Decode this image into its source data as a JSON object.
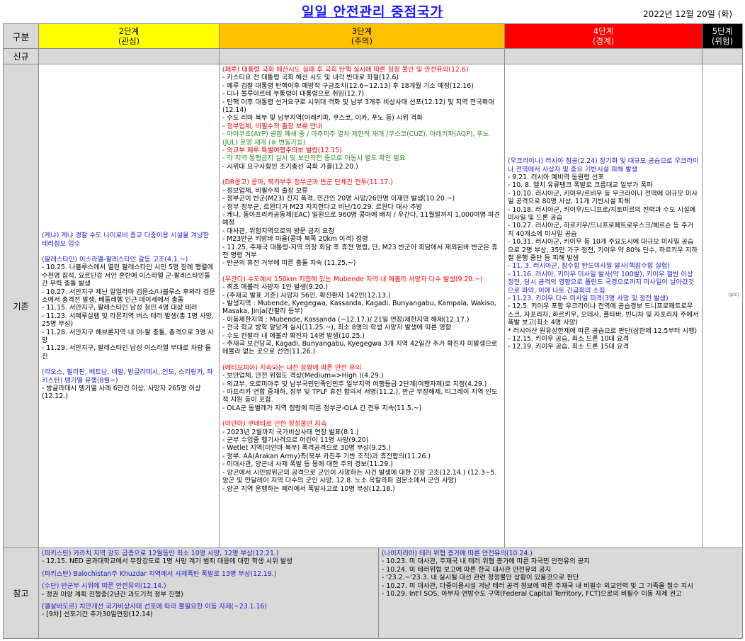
{
  "page": {
    "title": "일일 안전관리 중점국가",
    "date": "2022년  12월  20일 (화)"
  },
  "header": {
    "gubun": "구분",
    "level2": {
      "name": "2단계",
      "sub": "(관심)"
    },
    "level3": {
      "name": "3단계",
      "sub": "(주의)"
    },
    "level4": {
      "name": "4단계",
      "sub": "(경계)"
    },
    "level5": {
      "name": "5단계",
      "sub": "(위험)"
    }
  },
  "rows": {
    "new_label": "신규",
    "existing_label": "기존",
    "ref_label": "참고"
  },
  "level2": {
    "blocks": [
      {
        "head": "(케냐) 케냐 경찰 수도 나이로비 종교 다중이용 시설을 겨냥한 테러첩보 입수",
        "lines": []
      },
      {
        "head": "(팔레스타인) 이스라엘-팔레스타인 갈등 고조(4.1.~)",
        "lines": [
          "- 10.25. 나블루스에서 열린 팔레스타인 시민 5명 장례 행렬에 수천명 참석, 요르단강 서안 혼란에 이스라엘 군-팔레스타인들 간 무력 충돌 발생",
          "- 10.27. 서안지구 제닌 알일라마 검문소/나블루스 후와라 검문소에서 총격전 발생, 베들레헴 인근 데이세에서 총돌",
          "- 11.15. 서안지구, 팔레스타인 남성 청인 4명 대상 테러",
          "- 11.23. 서예루살렘 및 라몬지역 버스 테러 발생(총 1명 사망, 25명 부상)",
          "- 11.28. 서안지구 헤브론지역 내 이-팔 충돌, 총격으로 3명 사망",
          "- 11.29. 서안지구, 팔레스타인 남성 이스라엘 부대로 차량 돌진"
        ]
      },
      {
        "head": "(라오스, 필리핀, 베트남, 네팔, 방글라데시, 인도, 스리랑카, 파키스탄) 뎅기열 유행(8월~)",
        "lines": [
          "- 방글라데시 뎅기열 사례 6만건 이상, 사망자 265명 이상(12.12.)"
        ]
      }
    ]
  },
  "level3": {
    "blocks": [
      {
        "head": "(페루) 대통령 국회 해산시도 실패 후 국회 탄핵 실시에 따른 정정 불안 및 안전유의(12.6)",
        "lines": [
          {
            "t": "- 카스티요 전 대통령 국회 해산 시도 및 내각 반대로 좌절(12.6)",
            "c": "ln"
          },
          {
            "t": "- 페루 검찰 대통령 탄핵이후 예방적 구금조치(12.6~12.13) 후 18개월 기소 예정(12.16)",
            "c": "ln"
          },
          {
            "t": "- 디나 볼루아르테 부통령이 대통령으로 취임(12.7)",
            "c": "ln"
          },
          {
            "t": "- 탄핵 이후 대통령 선거요구로 시위대 격화 및 남부 3개주 비상사태 선포(12.12) 및 지역 전국확대(12.14)",
            "c": "ln"
          },
          {
            "t": "- 수도 리마 북부 및 남부지역(아레키파, 쿠스코, 이카, 푸노 등) 시위 격화",
            "c": "ln"
          },
          {
            "t": "- 정부업체, 비필수적 출장 보류 안내",
            "c": "ln-red"
          },
          {
            "t": "- 아야쿠초(AYP) 공항 폐쇄 중 / 마추피추 열차 제한적 재개 /쿠스코(CUZ), 아레키파(AQP), 푸노(JUL) 운영 재개  (※ 변동가능)",
            "c": "ln-green"
          },
          {
            "t": "- 외교부 페루 특별여행주의보 발령(12.15)",
            "c": "ln-red"
          },
          {
            "t": "- 각 지역 통행금지 실시 및 보안작전 중으로 이동시 별도 확인 필요",
            "c": "ln-green"
          },
          {
            "t": "- 시위대 요구사항인 조기총선 국회 가결(12.20.)",
            "c": "ln"
          }
        ]
      },
      {
        "head": "(DR콩고) 콩마, 북키부주 정부군과 반군 단체간 전투(11.17.)",
        "lines": [
          {
            "t": "- 정보업체, 비필수적 출장 보류",
            "c": "ln"
          },
          {
            "t": "- 정부군이 반군(M23) 진지 폭격, 민간인 20명 사망/26만명 이재민 발생(10.20.~)",
            "c": "ln"
          },
          {
            "t": "- 정부 정부군, 르완다가 M23 지지한다고 비난/10.29. 르완다 대사 추방",
            "c": "ln"
          },
          {
            "t": "- 케냐, 동아프리카공동체(EAC) 일원으로 960명 콩마에 배치 / 우간다, 11월말까지 1,000여명 파견 예정",
            "c": "ln"
          },
          {
            "t": "- 대사관, 위험지역으로의 방문 금지 요청",
            "c": "ln"
          },
          {
            "t": "- M23반군 키방바 마을(콩마 북쪽 20km 이격) 점령",
            "c": "ln"
          },
          {
            "t": "- 11.25. 주재국 대통령-지역 의장 회담 후 휴전 명령, 단, M23 반군이 회담에서 제외된바 반군은 휴전 명령 거부",
            "c": "ln"
          },
          {
            "t": "- 반군의 휴전 거부에 따른 충돌 지속 (11.25.~)",
            "c": "ln"
          }
        ]
      },
      {
        "head": "(우간다) 수도에서 150km 지점에 있는 Mubende 지역 내 에볼라 사망자 다수 발생(9.20.~)",
        "lines": [
          {
            "t": "- 최초 에볼라 사망자 1인 발생(9.20.)",
            "c": "ln"
          },
          {
            "t": "- (주재국 발표 기준) 사망자 56인, 확진환자 142인(12.13.)",
            "c": "ln"
          },
          {
            "t": "- 발생지역 : Mubende, Kyegegwa, Kassanda, Kagadi, Bunyangabu, Kampala, Wakiso, Masaka, Jinja(칸팔라 등부)",
            "c": "ln"
          },
          {
            "t": "- 이동제한지역 : Mubende, Kassanda (~12.17.)/ 21일 연장/제한지역 해제(12.17.)",
            "c": "ln"
          },
          {
            "t": "- 전국 학교 방학 앞당겨 실시(11.25.~), 최소 8명의 학생 사망자 발생에 따른 영향",
            "c": "ln"
          },
          {
            "t": "- 수도 칸팔라 내 에볼라 확진자 14명 발생(10.25.)",
            "c": "ln"
          },
          {
            "t": "- 주재국 보건당국, Kagadi, Bunyangabu, Kyegegwa 3개 지역 42일간 추가 확진자 미발생으로 에볼라 없는 곳으로 선언(11.26.)",
            "c": "ln"
          }
        ]
      },
      {
        "head": "(에티오피아) 지속되는 내전 상황에 따른 안전 유의",
        "lines": [
          {
            "t": "- 보안업체, 안전 위험도 격상(Medium=>High )(4.29.)",
            "c": "ln"
          },
          {
            "t": "- 외교부, 오로미아주 및 남부국민민족인민주 일부지역 여행등급 2단계(여행자제)로 지정(4.29.)",
            "c": "ln"
          },
          {
            "t": "- 아프리카 연합 중재하, 정부 및 TPLF 휴전 합의서 서명(11.2.), 반군 무장해제, 티그레이 지역 인도적 지원 등이 포함.",
            "c": "ln"
          },
          {
            "t": "- OLA군 동벨레가 지역 점령에 따른 정부군-OLA 간 전투 지속(11.5.~)",
            "c": "ln"
          }
        ]
      },
      {
        "head": "(미얀마) 쿠데타로 인한 정정불안 지속",
        "lines": [
          {
            "t": "- 2023년 2월까지 국가비상사태 연장 발표(8.1.)",
            "c": "ln"
          },
          {
            "t": "- 군부 수업중 헬기사격으로 어린이 11명 사망(9.20)",
            "c": "ln"
          },
          {
            "t": "- Wetlet 지역(미얀마 북부) 폭격공격으로 30명 부상(9.25.)",
            "c": "ln"
          },
          {
            "t": "- 정부. AA(Arakan Army)측(북부 카친주 기반 조직)과 휴전합의(11.26.)",
            "c": "ln"
          },
          {
            "t": "- 미대사관, 양곤내 사제 폭발 등 몽에 대한 주의 경보(11.29.)",
            "c": "ln"
          },
          {
            "t": "- 양곤에서 시민방위군의 공격으로 군인이 사망하는 사건 발생에 대한 긴장 고조(12.14.) (12.3~5. 양곤 및 만달레이 지역 다수의 군인 사망, 12.8. 노소 옥칼라파 검문소에서 군인 사망)",
            "c": "ln"
          },
          {
            "t": "- 양곤 지역 운행하는 페리에서 폭발사고로 10명 부상(12.18.)",
            "c": "ln"
          }
        ]
      }
    ]
  },
  "level4": {
    "blocks": [
      {
        "head": "(우크라이나) 러시아 침공(2.24) 장기화 및 대규모 공습으로 우크라이나 전역에서 사상자 및 중요 기반시설 피해 발생",
        "lines": [
          {
            "t": "- 9.21. 러시아 예비역 동원령 선포",
            "c": "ln"
          },
          {
            "t": "- 10. 8. 엘치 유류탱크 폭발로 크름대교 일부가 폭파",
            "c": "ln"
          },
          {
            "t": "- 10.10. 러시아군, 키이우/르비우 등 우크라이나 전역에 대규모 미사일 공격으로 80명 사상, 11개 기반시설 피해",
            "c": "ln"
          },
          {
            "t": "- 10.18. 러시아군, 키이우/드니프로/지토미르의 전력과 수도 시설에 미사일 및 드론 공습",
            "c": "ln"
          },
          {
            "t": "- 10.27. 러시아군, 하르키우/드니프로페트로우스크/헤르슨 등 주거지 40개소에 미사일 공습",
            "c": "ln"
          },
          {
            "t": "- 10.31. 러시아군, 키이우 등 10개 주요도시에 대규모 미사일 공습으로 2명 부상, 35만 가구 정전, 키이우 약 80% 단수, 하르키우 지하철 운행 중단 등 피해 발생",
            "c": "ln"
          },
          {
            "t": "- 11. 3. 러시아군, 잠수함 탄도미사일 발사(핵잠수함 실험)",
            "c": "ln-blue"
          },
          {
            "t": "- 11.16. 러시아, 키이우 미사일 발사(약 100발), 키이우 절반 이상 정전, 당시 공격의 영향으로 폴란드 국경으로까지 미사일이 날아갔것으로 파악, 이에 나토 긴급회의 소집",
            "c": "ln-blue"
          },
          {
            "t": "- 11.23. 키이우 다수 미사일 피격(3명 사망 및 정전 발생)",
            "c": "ln-blue"
          },
          {
            "t": "- 12.5. 키이우 포함 우크라이나 전역에 공습경보 드니프로페트로우스크, 자포리자, 하르키우, 오데사, 폴타바, 빈니차 및 자포리자 주에서 폭발 보고(최소 4명 사망)",
            "c": "ln"
          },
          {
            "t": "  * 러시아산 원유상한제에 따른 공습으로 판단(상한제 12.5부터 시행)",
            "c": "ln"
          },
          {
            "t": "- 12.15. 키이우 공습, 최소 드론 10대 요격",
            "c": "ln"
          },
          {
            "t": "- 12.19. 키이우 공습, 최소 드론 15대 요격",
            "c": "ln"
          }
        ]
      }
    ]
  },
  "reference": {
    "left": [
      {
        "head": "(파키스탄) 카라치 지역 강도 급증으로 12월동안 최소 10명 사망, 12명 부상(12.21.)",
        "lines": [
          "- 12.15. NED 공과대학교에서 무장강도로 1명 사망 계기 범죄 대응에 대한 학생 시위 발생"
        ]
      },
      {
        "head": "(파키스탄) Balochistan주 Khuzdar 지역에서 사제폭탄 폭발로 13명 부상(12.19.)",
        "lines": []
      },
      {
        "head": "(수단) 반군부 시위에 따른 안전유의(12.14.)",
        "lines": [
          "- 정권 이양 계획 진행중(2년간 과도기적 정부 진행)"
        ]
      },
      {
        "head": "(엘살바도르) 치안개선 국가비상사태 선포에 따라 불필요한 이동 자제(~23.1.16)",
        "lines": [
          "- [9차] 선포기간 추가30일연장(12.14)"
        ]
      }
    ],
    "right": [
      {
        "head": "(나이지리아) 테러 위협 증가에 따른 안전유의(10.24.)",
        "lines": [
          "- 10.23. 미 대사관, 주재국 내 테러 위협 증가에 따른 자국민 안전유의 공지",
          "- 10.24. 미 테러위협 보고에 따른 한국 대사관 안전유의 공지",
          "- '23.2.~'23.3. 내 실시될 대선 관련 정정불안 상황이 있을것으로 판단",
          "- 10.27. 미 대사관, 다중이용시설 겨냥 테러 공격 정보에 따른 주재국 내 비필수 외교인력 및 그 가족을 철수 지시",
          "- 10.29. Int'l SOS, 아부자 연방수도 구역(Federal Capital Territory, FCT)으로의 비필수 이동 자제 권고"
        ]
      }
    ]
  },
  "misc": {
    "level5_mark": "(pic)"
  }
}
